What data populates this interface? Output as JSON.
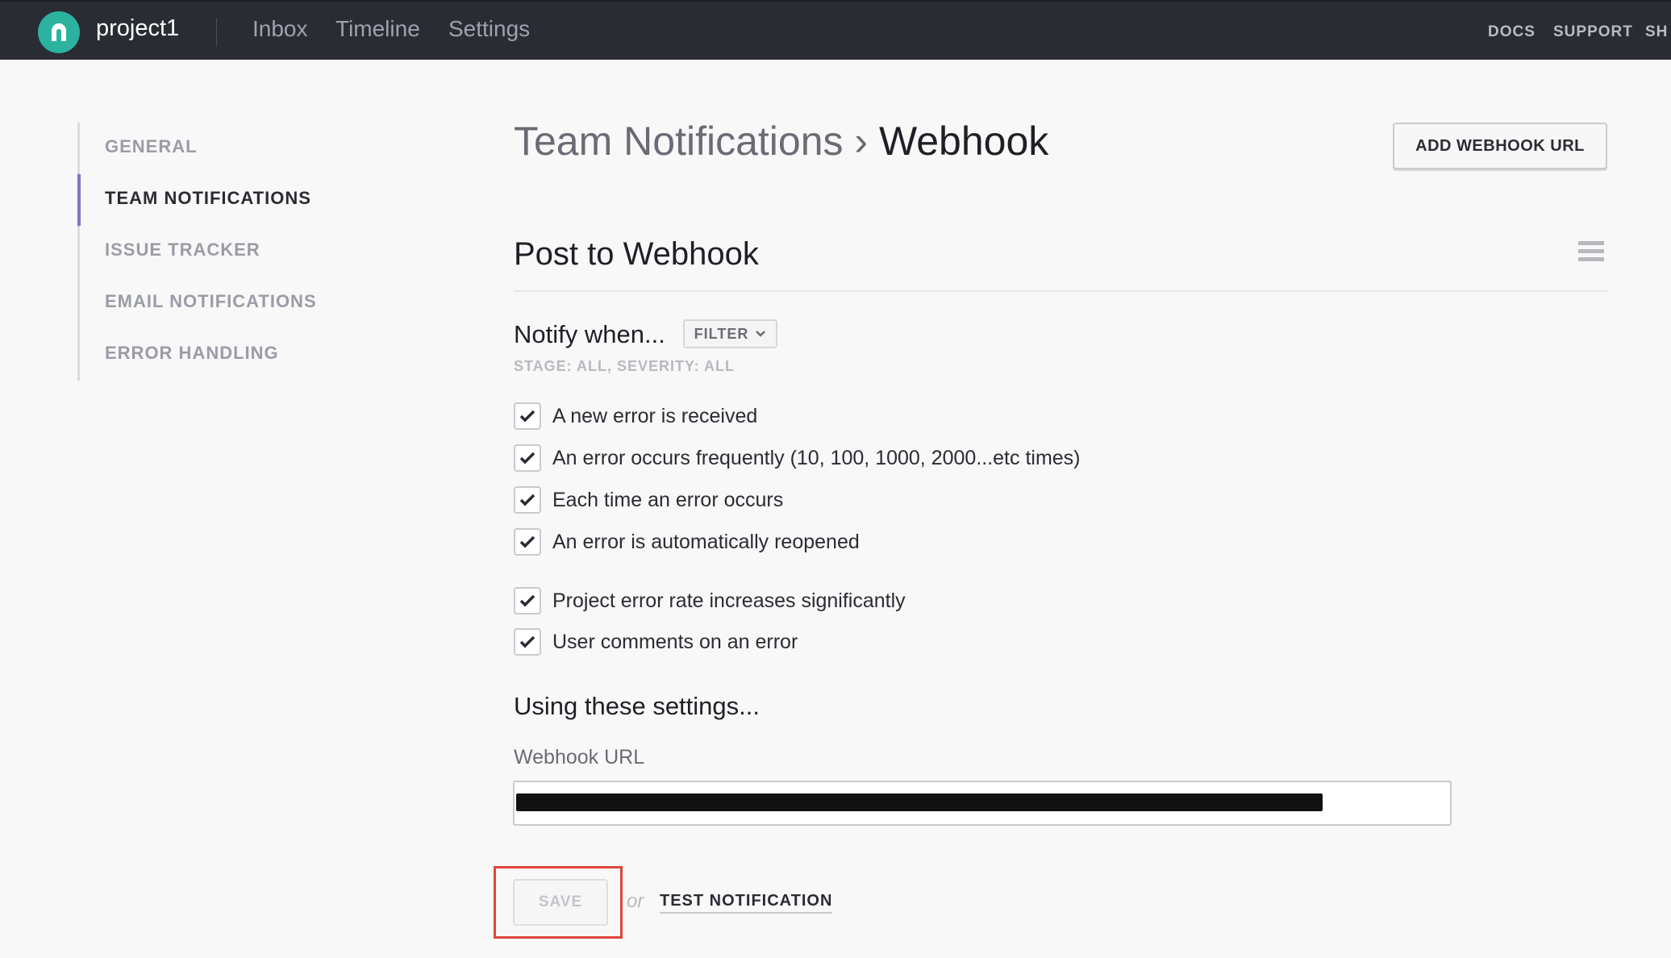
{
  "app": {
    "project_name": "project1",
    "nav": [
      {
        "label": "Inbox"
      },
      {
        "label": "Timeline"
      },
      {
        "label": "Settings"
      }
    ],
    "top_links": [
      {
        "label": "DOCS"
      },
      {
        "label": "SUPPORT"
      },
      {
        "label": "SH"
      }
    ],
    "brand_color": "#2bb3a0"
  },
  "sidebar": {
    "items": [
      {
        "label": "GENERAL",
        "active": false
      },
      {
        "label": "TEAM NOTIFICATIONS",
        "active": true
      },
      {
        "label": "ISSUE TRACKER",
        "active": false
      },
      {
        "label": "EMAIL NOTIFICATIONS",
        "active": false
      },
      {
        "label": "ERROR HANDLING",
        "active": false
      }
    ],
    "active_color": "#7a77c9"
  },
  "header": {
    "breadcrumb_parent": "Team Notifications",
    "breadcrumb_sep": " › ",
    "breadcrumb_current": "Webhook",
    "add_button": "ADD WEBHOOK URL"
  },
  "section": {
    "title": "Post to Webhook",
    "notify_label": "Notify when...",
    "filter_button": "FILTER",
    "filter_summary": "STAGE: ALL, SEVERITY: ALL",
    "conditions": [
      {
        "label": "A new error is received",
        "checked": true
      },
      {
        "label": "An error occurs frequently (10, 100, 1000, 2000...etc times)",
        "checked": true
      },
      {
        "label": "Each time an error occurs",
        "checked": true
      },
      {
        "label": "An error is automatically reopened",
        "checked": true
      },
      {
        "label": "Project error rate increases significantly",
        "checked": true
      },
      {
        "label": "User comments on an error",
        "checked": true
      }
    ],
    "settings_label": "Using these settings...",
    "webhook_url_label": "Webhook URL",
    "webhook_url_value": "",
    "save_button": "SAVE",
    "or_text": "or",
    "test_link": "TEST NOTIFICATION",
    "highlight_color": "#e0453a"
  }
}
